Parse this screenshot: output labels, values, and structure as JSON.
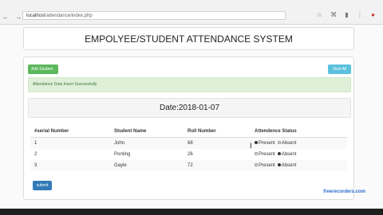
{
  "browser": {
    "nav_icons": "← → C ⓘ",
    "url_host": "localhost",
    "url_path": "/attendance/index.php",
    "right_icons": "☆ ⌘ ▮ ⋮",
    "ext_badge": "●"
  },
  "header": {
    "title": "EMPOLYEE/STUDENT ATTENDANCE SYSTEM"
  },
  "toolbar": {
    "add_label": "Add Student",
    "view_label": "View All"
  },
  "alert": {
    "message": "Attendance Data Insert Successfully"
  },
  "date": {
    "text": "Date:2018-01-07"
  },
  "table": {
    "headers": [
      "#serial Number",
      "Student Name",
      "Roll Number",
      "Attendence Status"
    ],
    "status_options": [
      "Present",
      "Absent"
    ],
    "rows": [
      {
        "serial": "1",
        "name": "John",
        "roll": "68",
        "status": "Present"
      },
      {
        "serial": "2",
        "name": "Ponting",
        "roll": "26",
        "status": "Absent"
      },
      {
        "serial": "3",
        "name": "Gayle",
        "roll": "72",
        "status": "Absent"
      }
    ]
  },
  "submit_label": "submit",
  "watermark": "freerecorders.com",
  "colors": {
    "success": "#5cb85c",
    "info": "#5bc0de",
    "primary": "#337ab7",
    "alert_bg": "#dff0d8"
  }
}
